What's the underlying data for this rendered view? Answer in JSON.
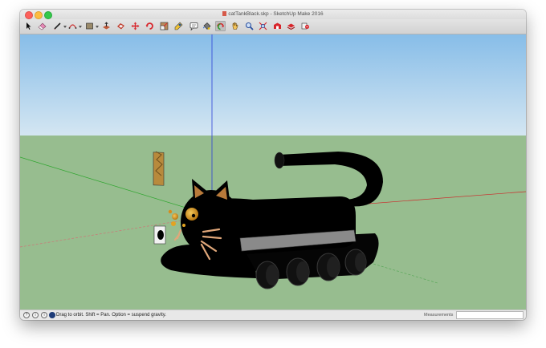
{
  "window": {
    "title": "catTankBlack.skp - SketchUp Make 2016"
  },
  "toolbar": {
    "tools": [
      {
        "name": "select",
        "icon": "select-arrow-icon",
        "active": false
      },
      {
        "name": "eraser",
        "icon": "eraser-icon",
        "active": false
      },
      {
        "name": "line",
        "icon": "pencil-line-icon",
        "active": false,
        "dropdown": true
      },
      {
        "name": "arc",
        "icon": "arc-icon",
        "active": false,
        "dropdown": true
      },
      {
        "name": "rectangle",
        "icon": "rectangle-icon",
        "active": false,
        "dropdown": true
      },
      {
        "name": "push-pull",
        "icon": "push-pull-icon",
        "active": false
      },
      {
        "name": "offset",
        "icon": "offset-icon",
        "active": false
      },
      {
        "name": "move",
        "icon": "move-icon",
        "active": false
      },
      {
        "name": "rotate",
        "icon": "rotate-icon",
        "active": false
      },
      {
        "name": "scale",
        "icon": "scale-icon",
        "active": false
      },
      {
        "name": "tape-measure",
        "icon": "tape-measure-icon",
        "active": false
      },
      {
        "name": "text",
        "icon": "text-icon",
        "active": false
      },
      {
        "name": "paint-bucket",
        "icon": "paint-bucket-icon",
        "active": false
      },
      {
        "name": "orbit",
        "icon": "orbit-icon",
        "active": true
      },
      {
        "name": "pan",
        "icon": "pan-hand-icon",
        "active": false
      },
      {
        "name": "zoom",
        "icon": "zoom-icon",
        "active": false
      },
      {
        "name": "zoom-extents",
        "icon": "zoom-extents-icon",
        "active": false
      },
      {
        "name": "3d-warehouse",
        "icon": "warehouse-icon",
        "active": false
      },
      {
        "name": "extension-warehouse",
        "icon": "extension-warehouse-icon",
        "active": false
      },
      {
        "name": "send-to-layout",
        "icon": "send-to-layout-icon",
        "active": false
      }
    ]
  },
  "statusbar": {
    "hint": "Drag to orbit. Shift = Pan. Option = suspend gravity.",
    "measurements_label": "Measurements",
    "measurements_value": ""
  },
  "colors": {
    "sky_top": "#87bde8",
    "sky_bottom": "#d4e6f2",
    "ground": "#97bd8f",
    "cat_body": "#000000",
    "tread_band": "#8a8a8a",
    "eye": "#e2a322",
    "whisker": "#e0a77a",
    "axis_red": "#cc2b2b",
    "axis_green": "#2fa62f",
    "axis_blue": "#2b3fd6"
  }
}
